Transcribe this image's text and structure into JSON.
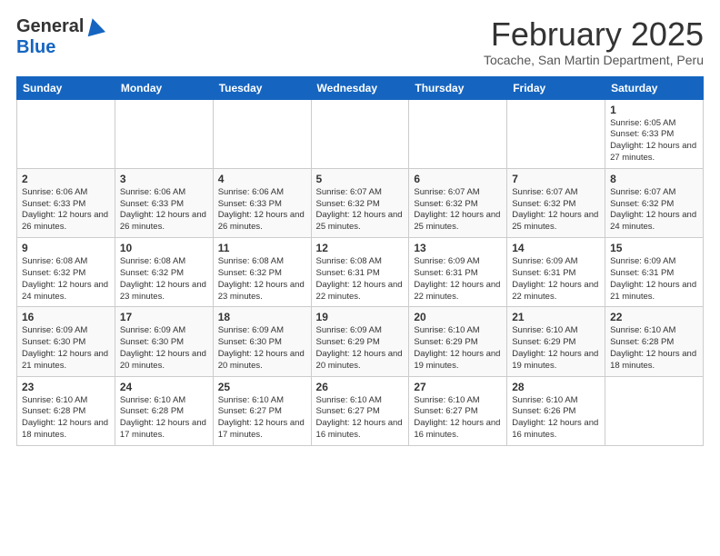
{
  "header": {
    "logo_general": "General",
    "logo_blue": "Blue",
    "month_title": "February 2025",
    "location": "Tocache, San Martin Department, Peru"
  },
  "days_of_week": [
    "Sunday",
    "Monday",
    "Tuesday",
    "Wednesday",
    "Thursday",
    "Friday",
    "Saturday"
  ],
  "weeks": [
    [
      {
        "day": "",
        "info": ""
      },
      {
        "day": "",
        "info": ""
      },
      {
        "day": "",
        "info": ""
      },
      {
        "day": "",
        "info": ""
      },
      {
        "day": "",
        "info": ""
      },
      {
        "day": "",
        "info": ""
      },
      {
        "day": "1",
        "info": "Sunrise: 6:05 AM\nSunset: 6:33 PM\nDaylight: 12 hours and 27 minutes."
      }
    ],
    [
      {
        "day": "2",
        "info": "Sunrise: 6:06 AM\nSunset: 6:33 PM\nDaylight: 12 hours and 26 minutes."
      },
      {
        "day": "3",
        "info": "Sunrise: 6:06 AM\nSunset: 6:33 PM\nDaylight: 12 hours and 26 minutes."
      },
      {
        "day": "4",
        "info": "Sunrise: 6:06 AM\nSunset: 6:33 PM\nDaylight: 12 hours and 26 minutes."
      },
      {
        "day": "5",
        "info": "Sunrise: 6:07 AM\nSunset: 6:32 PM\nDaylight: 12 hours and 25 minutes."
      },
      {
        "day": "6",
        "info": "Sunrise: 6:07 AM\nSunset: 6:32 PM\nDaylight: 12 hours and 25 minutes."
      },
      {
        "day": "7",
        "info": "Sunrise: 6:07 AM\nSunset: 6:32 PM\nDaylight: 12 hours and 25 minutes."
      },
      {
        "day": "8",
        "info": "Sunrise: 6:07 AM\nSunset: 6:32 PM\nDaylight: 12 hours and 24 minutes."
      }
    ],
    [
      {
        "day": "9",
        "info": "Sunrise: 6:08 AM\nSunset: 6:32 PM\nDaylight: 12 hours and 24 minutes."
      },
      {
        "day": "10",
        "info": "Sunrise: 6:08 AM\nSunset: 6:32 PM\nDaylight: 12 hours and 23 minutes."
      },
      {
        "day": "11",
        "info": "Sunrise: 6:08 AM\nSunset: 6:32 PM\nDaylight: 12 hours and 23 minutes."
      },
      {
        "day": "12",
        "info": "Sunrise: 6:08 AM\nSunset: 6:31 PM\nDaylight: 12 hours and 22 minutes."
      },
      {
        "day": "13",
        "info": "Sunrise: 6:09 AM\nSunset: 6:31 PM\nDaylight: 12 hours and 22 minutes."
      },
      {
        "day": "14",
        "info": "Sunrise: 6:09 AM\nSunset: 6:31 PM\nDaylight: 12 hours and 22 minutes."
      },
      {
        "day": "15",
        "info": "Sunrise: 6:09 AM\nSunset: 6:31 PM\nDaylight: 12 hours and 21 minutes."
      }
    ],
    [
      {
        "day": "16",
        "info": "Sunrise: 6:09 AM\nSunset: 6:30 PM\nDaylight: 12 hours and 21 minutes."
      },
      {
        "day": "17",
        "info": "Sunrise: 6:09 AM\nSunset: 6:30 PM\nDaylight: 12 hours and 20 minutes."
      },
      {
        "day": "18",
        "info": "Sunrise: 6:09 AM\nSunset: 6:30 PM\nDaylight: 12 hours and 20 minutes."
      },
      {
        "day": "19",
        "info": "Sunrise: 6:09 AM\nSunset: 6:29 PM\nDaylight: 12 hours and 20 minutes."
      },
      {
        "day": "20",
        "info": "Sunrise: 6:10 AM\nSunset: 6:29 PM\nDaylight: 12 hours and 19 minutes."
      },
      {
        "day": "21",
        "info": "Sunrise: 6:10 AM\nSunset: 6:29 PM\nDaylight: 12 hours and 19 minutes."
      },
      {
        "day": "22",
        "info": "Sunrise: 6:10 AM\nSunset: 6:28 PM\nDaylight: 12 hours and 18 minutes."
      }
    ],
    [
      {
        "day": "23",
        "info": "Sunrise: 6:10 AM\nSunset: 6:28 PM\nDaylight: 12 hours and 18 minutes."
      },
      {
        "day": "24",
        "info": "Sunrise: 6:10 AM\nSunset: 6:28 PM\nDaylight: 12 hours and 17 minutes."
      },
      {
        "day": "25",
        "info": "Sunrise: 6:10 AM\nSunset: 6:27 PM\nDaylight: 12 hours and 17 minutes."
      },
      {
        "day": "26",
        "info": "Sunrise: 6:10 AM\nSunset: 6:27 PM\nDaylight: 12 hours and 16 minutes."
      },
      {
        "day": "27",
        "info": "Sunrise: 6:10 AM\nSunset: 6:27 PM\nDaylight: 12 hours and 16 minutes."
      },
      {
        "day": "28",
        "info": "Sunrise: 6:10 AM\nSunset: 6:26 PM\nDaylight: 12 hours and 16 minutes."
      },
      {
        "day": "",
        "info": ""
      }
    ]
  ]
}
